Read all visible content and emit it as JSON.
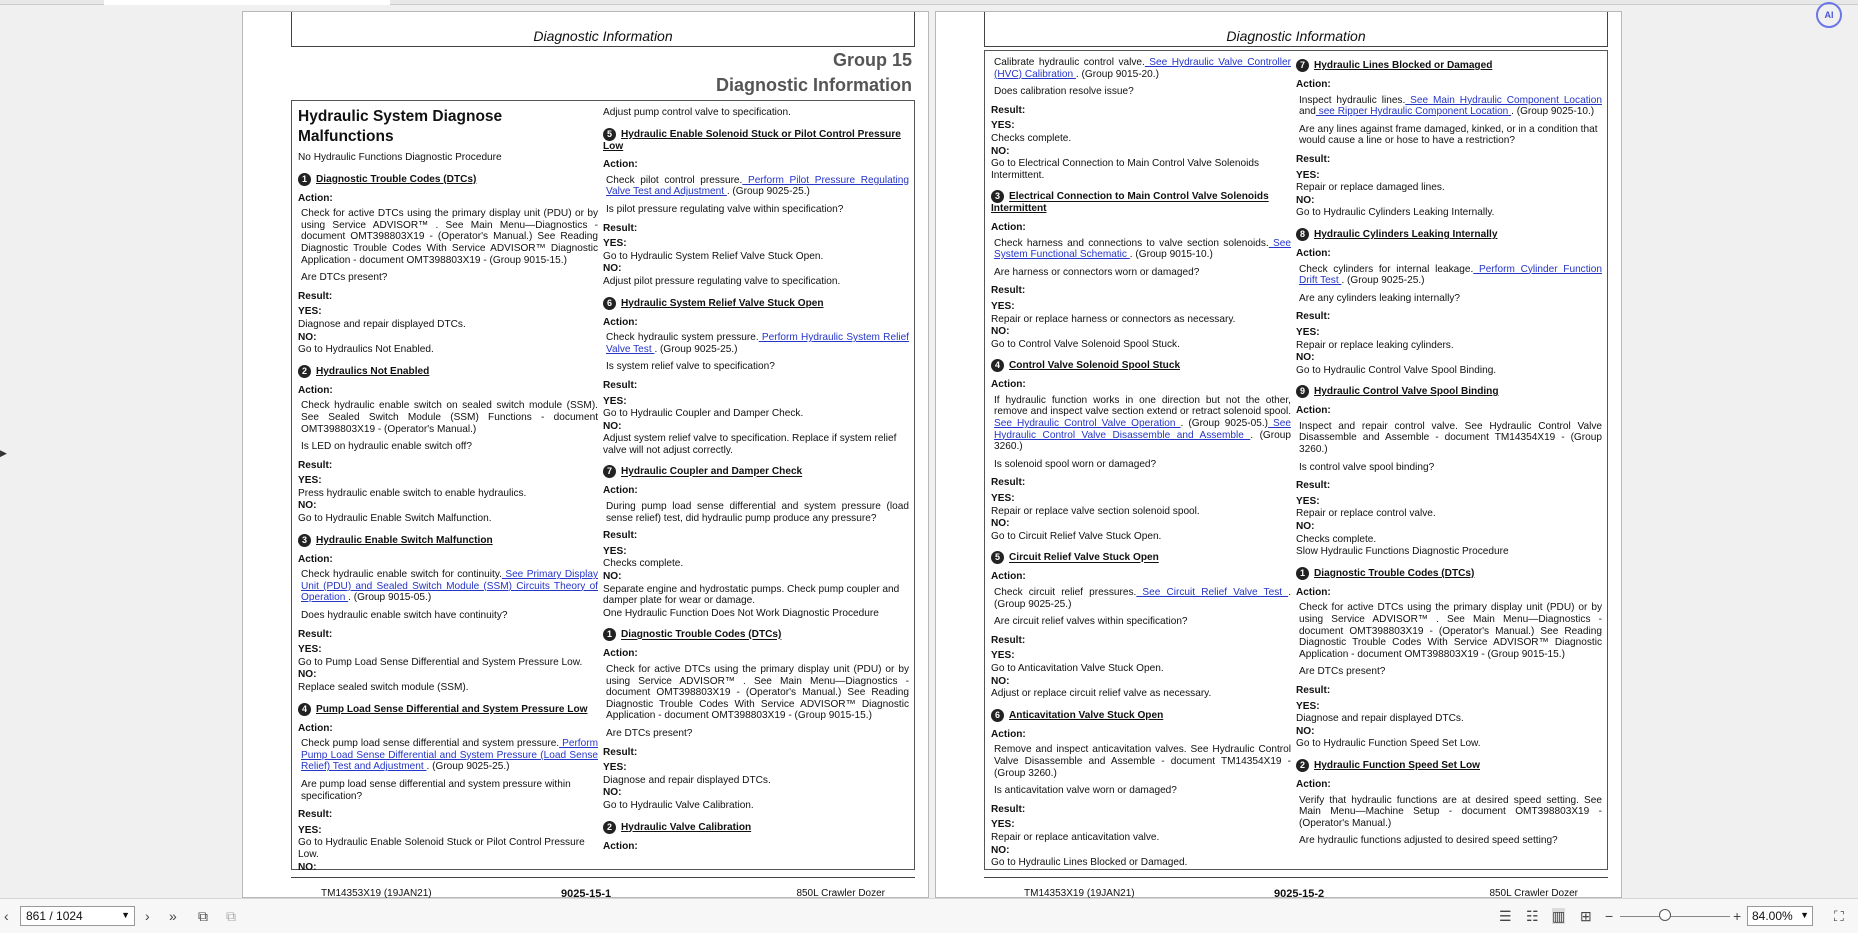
{
  "ui": {
    "ai_button": "AI",
    "page_indicator": "861 / 1024",
    "zoom": "84.00%",
    "icons": [
      "prev-page-icon",
      "next-page-icon",
      "last-page-icon",
      "thumbnails-icon",
      "rotate-icon",
      "single-page-icon",
      "continuous-icon",
      "two-page-icon",
      "grid-icon",
      "zoom-out-icon",
      "zoom-in-icon",
      "fullscreen-icon"
    ]
  },
  "page1": {
    "running_head": "Diagnostic Information",
    "group": "Group 15",
    "group_title": "Diagnostic Information",
    "footer": {
      "left": "TM14353X19 (19JAN21)",
      "center": "9025-15-1",
      "right": "850L Crawler Dozer"
    },
    "col1": {
      "heading": "Hydraulic System Diagnose Malfunctions",
      "intro": "No Hydraulic Functions Diagnostic Procedure",
      "s1_num": "1",
      "s1_title": "Diagnostic Trouble Codes (DTCs)",
      "action": "Action:",
      "result": "Result:",
      "yes": "YES:",
      "no": "NO:",
      "s1_text": "Check for active DTCs using the primary display unit (PDU) or by using Service ADVISOR™ . See Main Menu—Diagnostics - document OMT398803X19 - (Operator's Manual.) See Reading Diagnostic Trouble Codes With Service ADVISOR™ Diagnostic Application - document OMT398803X19 - (Group 9015-15.)",
      "s1_q": "Are DTCs present?",
      "s1_yes": "Diagnose and repair displayed DTCs.",
      "s1_no": "Go to Hydraulics Not Enabled.",
      "s2_num": "2",
      "s2_title": "Hydraulics Not Enabled",
      "s2_text": "Check hydraulic enable switch on sealed switch module (SSM). See Sealed Switch Module (SSM) Functions - document OMT398803X19 - (Operator's Manual.)",
      "s2_q": "Is LED on hydraulic enable switch off?",
      "s2_yes": "Press hydraulic enable switch to enable hydraulics.",
      "s2_no": "Go to Hydraulic Enable Switch Malfunction.",
      "s3_num": "3",
      "s3_title": "Hydraulic Enable Switch Malfunction",
      "s3_pre": "Check hydraulic enable switch for continuity.",
      "s3_link": " See Primary Display Unit (PDU) and Sealed Switch Module (SSM) Circuits Theory of Operation ",
      "s3_post": ". (Group 9015-05.)",
      "s3_q": "Does hydraulic enable switch have continuity?",
      "s3_yes": "Go to Pump Load Sense Differential and System Pressure Low.",
      "s3_no": "Replace sealed switch module (SSM).",
      "s4_num": "4",
      "s4_title": "Pump Load Sense Differential and System Pressure Low",
      "s4_pre": "Check pump load sense differential and system pressure.",
      "s4_link": " Perform Pump Load Sense Differential and System Pressure (Load Sense Relief) Test and Adjustment ",
      "s4_post": ". (Group 9025-25.)",
      "s4_q": "Are pump load sense differential and system pressure within specification?",
      "s4_yes": "Go to Hydraulic Enable Solenoid Stuck or Pilot Control Pressure Low."
    },
    "col2": {
      "top": "Adjust pump control valve to specification.",
      "s5_num": "5",
      "s5_title": "Hydraulic Enable Solenoid Stuck or Pilot Control Pressure Low",
      "s5_pre": "Check pilot control pressure.",
      "s5_link": " Perform Pilot Pressure Regulating Valve Test and Adjustment ",
      "s5_post": ". (Group 9025-25.)",
      "s5_q": "Is pilot pressure regulating valve within specification?",
      "s5_yes": "Go to Hydraulic System Relief Valve Stuck Open.",
      "s5_no": "Adjust pilot pressure regulating valve to specification.",
      "s6_num": "6",
      "s6_title": "Hydraulic System Relief Valve Stuck Open",
      "s6_pre": "Check hydraulic system pressure.",
      "s6_link": " Perform Hydraulic System Relief Valve Test ",
      "s6_post": ". (Group 9025-25.)",
      "s6_q": "Is system relief valve to specification?",
      "s6_yes": "Go to Hydraulic Coupler and Damper Check.",
      "s6_no": "Adjust system relief valve to specification. Replace if system relief valve will not adjust correctly.",
      "s7_num": "7",
      "s7_title": "Hydraulic Coupler and Damper Check",
      "s7_text": "During pump load sense differential and system pressure (load sense relief) test, did hydraulic pump produce any pressure?",
      "s7_yes": "Checks complete.",
      "s7_no": "Separate engine and hydrostatic pumps. Check pump coupler and damper plate for wear or damage.",
      "proc2": "One Hydraulic Function Does Not Work Diagnostic Procedure",
      "d1_num": "1",
      "d1_title": "Diagnostic Trouble Codes (DTCs)",
      "d1_text": "Check for active DTCs using the primary display unit (PDU) or by using Service ADVISOR™ . See Main Menu—Diagnostics - document OMT398803X19 - (Operator's Manual.) See Reading Diagnostic Trouble Codes With Service ADVISOR™ Diagnostic Application - document OMT398803X19 - (Group 9015-15.)",
      "d1_q": "Are DTCs present?",
      "d1_yes": "Diagnose and repair displayed DTCs.",
      "d1_no": "Go to Hydraulic Valve Calibration.",
      "d2_num": "2",
      "d2_title": "Hydraulic Valve Calibration"
    }
  },
  "page2": {
    "running_head": "Diagnostic Information",
    "footer": {
      "left": "TM14353X19 (19JAN21)",
      "center": "9025-15-2",
      "right": "850L Crawler Dozer"
    },
    "col1": {
      "c_pre": "Calibrate hydraulic control valve.",
      "c_link": " See Hydraulic Valve Controller (HVC) Calibration ",
      "c_post": ". (Group 9015-20.)",
      "c_q": "Does calibration resolve issue?",
      "c_yes": "Checks complete.",
      "c_no": "Go to Electrical Connection to Main Control Valve Solenoids Intermittent.",
      "s3_num": "3",
      "s3_title": "Electrical Connection to Main Control Valve Solenoids Intermittent",
      "s3_pre": "Check harness and connections to valve section solenoids.",
      "s3_link": " See System Functional Schematic ",
      "s3_post": ". (Group 9015-10.)",
      "s3_q": "Are harness or connectors worn or damaged?",
      "s3_yes": "Repair or replace harness or connectors as necessary.",
      "s3_no": "Go to Control Valve Solenoid Spool Stuck.",
      "s4_num": "4",
      "s4_title": "Control Valve Solenoid Spool Stuck",
      "s4_pre": "If hydraulic function works in one direction but not the other, remove and inspect valve section extend or retract solenoid spool.",
      "s4_link1": " See Hydraulic Control Valve Operation ",
      "s4_mid": ". (Group 9025-05.)",
      "s4_link2": " See Hydraulic Control Valve Disassemble and Assemble ",
      "s4_post": ". (Group 3260.)",
      "s4_q": "Is solenoid spool worn or damaged?",
      "s4_yes": "Repair or replace valve section solenoid spool.",
      "s4_no": "Go to Circuit Relief Valve Stuck Open.",
      "s5_num": "5",
      "s5_title": "Circuit Relief Valve Stuck Open",
      "s5_pre": "Check circuit relief pressures.",
      "s5_link": " See Circuit Relief Valve Test ",
      "s5_post": ". (Group 9025-25.)",
      "s5_q": "Are circuit relief valves within specification?",
      "s5_yes": "Go to Anticavitation Valve Stuck Open.",
      "s5_no": "Adjust or replace circuit relief valve as necessary.",
      "s6_num": "6",
      "s6_title": "Anticavitation Valve Stuck Open",
      "s6_text": "Remove and inspect anticavitation valves. See Hydraulic Control Valve Disassemble and Assemble - document TM14354X19 - (Group 3260.)",
      "s6_q": "Is anticavitation valve worn or damaged?",
      "s6_yes": "Repair or replace anticavitation valve.",
      "s6_no": "Go to Hydraulic Lines Blocked or Damaged."
    },
    "col2": {
      "s7_num": "7",
      "s7_title": "Hydraulic Lines Blocked or Damaged",
      "s7_pre": "Inspect hydraulic lines.",
      "s7_link1": " See Main Hydraulic Component Location ",
      "s7_and": "and",
      "s7_link2": " see Ripper Hydraulic Component Location ",
      "s7_post": ". (Group 9025-10.)",
      "s7_q": "Are any lines against frame damaged, kinked, or in a condition that would cause a line or hose to have a restriction?",
      "s7_yes": "Repair or replace damaged lines.",
      "s7_no": "Go to Hydraulic Cylinders Leaking Internally.",
      "s8_num": "8",
      "s8_title": "Hydraulic Cylinders Leaking Internally",
      "s8_pre": "Check cylinders for internal leakage.",
      "s8_link": " Perform Cylinder Function Drift Test ",
      "s8_post": ". (Group 9025-25.)",
      "s8_q": "Are any cylinders leaking internally?",
      "s8_yes": "Repair or replace leaking cylinders.",
      "s8_no": "Go to Hydraulic Control Valve Spool Binding.",
      "s9_num": "9",
      "s9_title": "Hydraulic Control Valve Spool Binding",
      "s9_text": "Inspect and repair control valve. See Hydraulic Control Valve Disassemble and Assemble - document TM14354X19 - (Group 3260.)",
      "s9_q": "Is control valve spool binding?",
      "s9_yes": "Repair or replace control valve.",
      "s9_no": "Checks complete.",
      "proc3": "Slow Hydraulic Functions Diagnostic Procedure",
      "d1_num": "1",
      "d1_title": "Diagnostic Trouble Codes (DTCs)",
      "d1_text": "Check for active DTCs using the primary display unit (PDU) or by using Service ADVISOR™ . See Main Menu—Diagnostics - document OMT398803X19 - (Operator's Manual.) See Reading Diagnostic Trouble Codes With Service ADVISOR™ Diagnostic Application - document OMT398803X19 - (Group 9015-15.)",
      "d1_q": "Are DTCs present?",
      "d1_yes": "Diagnose and repair displayed DTCs.",
      "d1_no": "Go to Hydraulic Function Speed Set Low.",
      "d2_num": "2",
      "d2_title": "Hydraulic Function Speed Set Low",
      "d2_text": "Verify that hydraulic functions are at desired speed setting. See Main Menu—Machine Setup - document OMT398803X19 - (Operator's Manual.)",
      "d2_q": "Are hydraulic functions adjusted to desired speed setting?"
    }
  }
}
